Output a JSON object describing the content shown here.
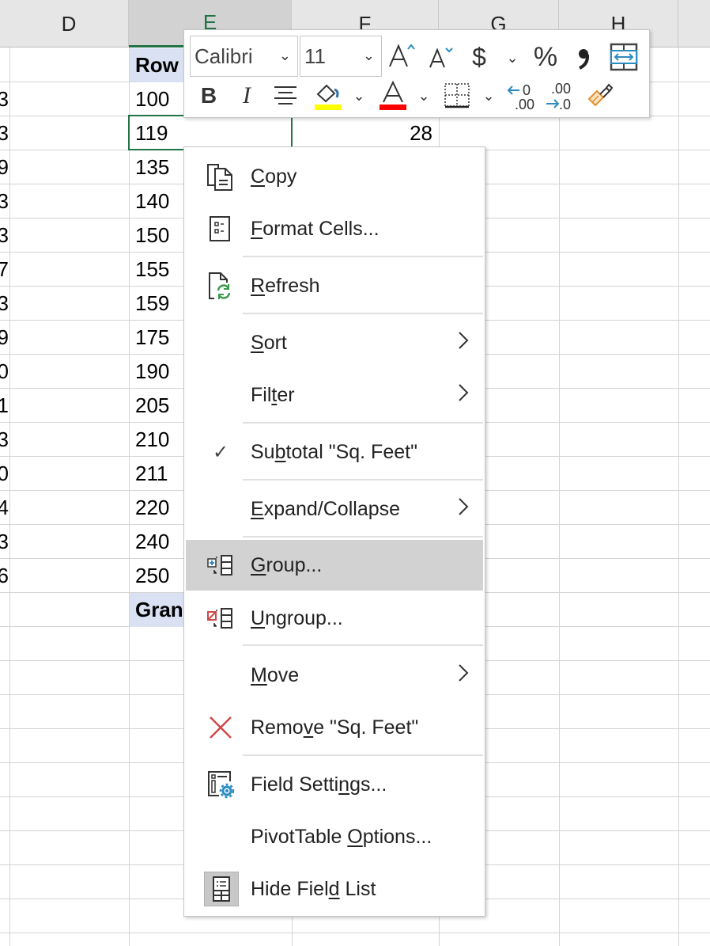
{
  "sheet": {
    "column_headers": [
      "D",
      "E",
      "F",
      "G",
      "H"
    ],
    "selected_column": "E",
    "column_c_partial_digits": [
      "3",
      "3",
      "9",
      "3",
      "3",
      "7",
      "3",
      "9",
      "0",
      "1",
      "3",
      "0",
      "4",
      "3",
      "6"
    ],
    "pivot_header": "Row Labels",
    "row_labels": [
      "100",
      "119",
      "135",
      "140",
      "150",
      "155",
      "159",
      "175",
      "190",
      "205",
      "210",
      "211",
      "220",
      "240",
      "250"
    ],
    "grand_total_label": "Grand Total",
    "active_cell_value_f": "28"
  },
  "mini_toolbar": {
    "font_name": "Calibri",
    "font_size": "11",
    "buttons_row1": [
      {
        "name": "increase-font-size",
        "glyph": "A^"
      },
      {
        "name": "decrease-font-size",
        "glyph": "Aˇ"
      },
      {
        "name": "accounting-format",
        "glyph": "$"
      },
      {
        "name": "percent-style",
        "glyph": "%"
      },
      {
        "name": "comma-style",
        "glyph": ","
      },
      {
        "name": "autofit-columns",
        "glyph": "↔"
      }
    ],
    "buttons_row2": [
      {
        "name": "bold",
        "glyph": "B"
      },
      {
        "name": "italic",
        "glyph": "I"
      },
      {
        "name": "center",
        "glyph": "≡"
      },
      {
        "name": "fill-color",
        "glyph": "bucket"
      },
      {
        "name": "font-color",
        "glyph": "A"
      },
      {
        "name": "borders",
        "glyph": "grid"
      },
      {
        "name": "increase-decimal",
        "glyph": "←.0 .00"
      },
      {
        "name": "decrease-decimal",
        "glyph": ".00 →.0"
      },
      {
        "name": "format-painter",
        "glyph": "brush"
      }
    ],
    "colors": {
      "fill": "#ffff00",
      "font": "#ff0000",
      "accent_blue": "#2e8bc0"
    }
  },
  "context_menu": {
    "items": [
      {
        "id": "copy",
        "pre": "",
        "key": "C",
        "post": "opy",
        "icon": "copy-icon"
      },
      {
        "id": "format-cells",
        "pre": "",
        "key": "F",
        "post": "ormat Cells...",
        "icon": "format-cells-icon"
      },
      {
        "id": "refresh",
        "pre": "",
        "key": "R",
        "post": "efresh",
        "icon": "refresh-icon"
      },
      {
        "id": "sort",
        "pre": "",
        "key": "S",
        "post": "ort",
        "submenu": true
      },
      {
        "id": "filter",
        "pre": "Fil",
        "key": "t",
        "post": "er",
        "submenu": true
      },
      {
        "id": "subtotal",
        "pre": "Su",
        "key": "b",
        "post": "total \"Sq. Feet\"",
        "checked": true
      },
      {
        "id": "expand-collapse",
        "pre": "",
        "key": "E",
        "post": "xpand/Collapse",
        "submenu": true
      },
      {
        "id": "group",
        "pre": "",
        "key": "G",
        "post": "roup...",
        "icon": "group-icon",
        "highlighted": true
      },
      {
        "id": "ungroup",
        "pre": "",
        "key": "U",
        "post": "ngroup...",
        "icon": "ungroup-icon"
      },
      {
        "id": "move",
        "pre": "",
        "key": "M",
        "post": "ove",
        "submenu": true
      },
      {
        "id": "remove",
        "pre": "Remo",
        "key": "v",
        "post": "e \"Sq. Feet\"",
        "icon": "remove-icon"
      },
      {
        "id": "field-settings",
        "pre": "Field Setti",
        "key": "n",
        "post": "gs...",
        "icon": "field-settings-icon"
      },
      {
        "id": "pivottable-options",
        "pre": "PivotTable ",
        "key": "O",
        "post": "ptions..."
      },
      {
        "id": "hide-field-list",
        "pre": "Hide Fiel",
        "key": "d",
        "post": " List",
        "icon": "field-list-icon"
      }
    ],
    "check_glyph": "✓",
    "submenu_glyph": "›"
  }
}
